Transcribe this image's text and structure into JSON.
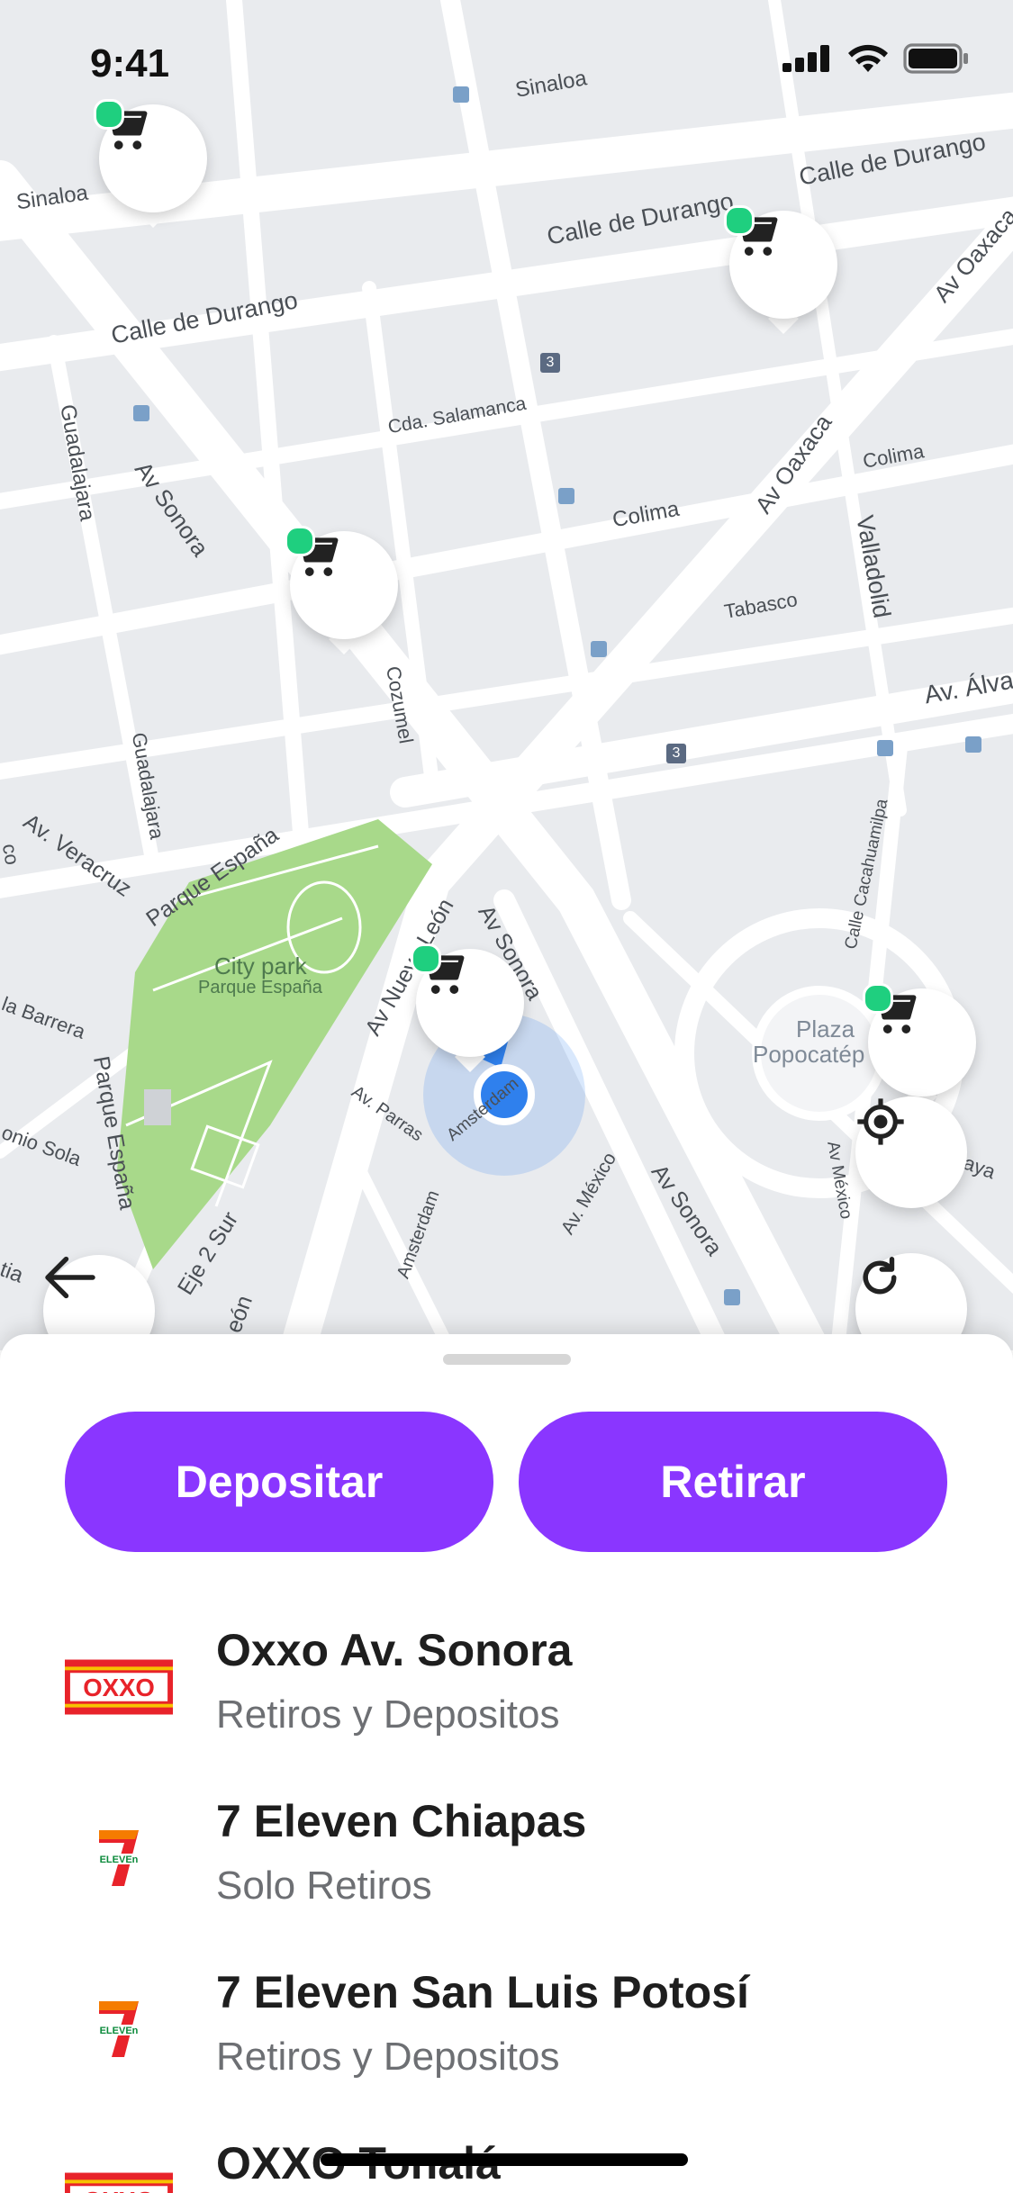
{
  "status_bar": {
    "time": "9:41"
  },
  "map": {
    "labels": {
      "sinaloa_left": "Sinaloa",
      "sinaloa_top": "Sinaloa",
      "durango_left": "Calle de Durango",
      "durango_mid": "Calle de Durango",
      "durango_right": "Calle de Durango",
      "guadalajara_top": "Guadalajara",
      "av_sonora_top": "Av Sonora",
      "cda_salamanca": "Cda. Salamanca",
      "colima_mid": "Colima",
      "colima_right": "Colima",
      "av_oaxaca_mid": "Av Oaxaca",
      "av_oaxaca_top": "Av Oaxaca",
      "valladolid": "Valladolid",
      "tabasco": "Tabasco",
      "cozumel": "Cozumel",
      "guadalajara_mid": "Guadalajara",
      "av_alvaro": "Av. Álva",
      "av_veracruz": "Av. Veracruz",
      "parque_espana_top": "Parque España",
      "city_park": "City park",
      "parque_espana_park": "Parque España",
      "av_nuevo_leon": "Av Nuevo León",
      "av_sonora_mid": "Av Sonora",
      "calle_cacahuamilpa": "Calle Cacahuamilpa",
      "plaza": "Plaza",
      "popocatepetl": "Popocatép",
      "la_barrera": "la Barrera",
      "parque_espana_vert": "Parque España",
      "onio_sola": "onio Sola",
      "av_parras": "Av. Parras",
      "amsterdam_top": "Amsterdam",
      "av_mexico_right": "Av México",
      "av_mexico_mid": "Av. México",
      "av_sonora_bottom": "Av Sonora",
      "amsterdam_bottom": "Amsterdam",
      "eje_2_sur": "Eje 2 Sur",
      "leon": "León",
      "tia": "tia",
      "aya": "aya",
      "co": "co"
    },
    "route_badges": [
      "3",
      "3"
    ]
  },
  "sheet": {
    "deposit_label": "Depositar",
    "withdraw_label": "Retirar",
    "stores": [
      {
        "name": "Oxxo Av. Sonora",
        "type": "Retiros y Depositos",
        "brand": "oxxo-logo"
      },
      {
        "name": "7 Eleven Chiapas",
        "type": "Solo Retiros",
        "brand": "seven-eleven-logo"
      },
      {
        "name": "7 Eleven San Luis Potosí",
        "type": "Retiros y Depositos",
        "brand": "seven-eleven-logo"
      },
      {
        "name": "OXXO Tonalá",
        "type": "",
        "brand": "oxxo-logo"
      }
    ]
  },
  "colors": {
    "accent": "#8a36ff",
    "pin_dot": "#1fcf7f",
    "park": "#a8d98a",
    "location": "#2f80ed"
  }
}
